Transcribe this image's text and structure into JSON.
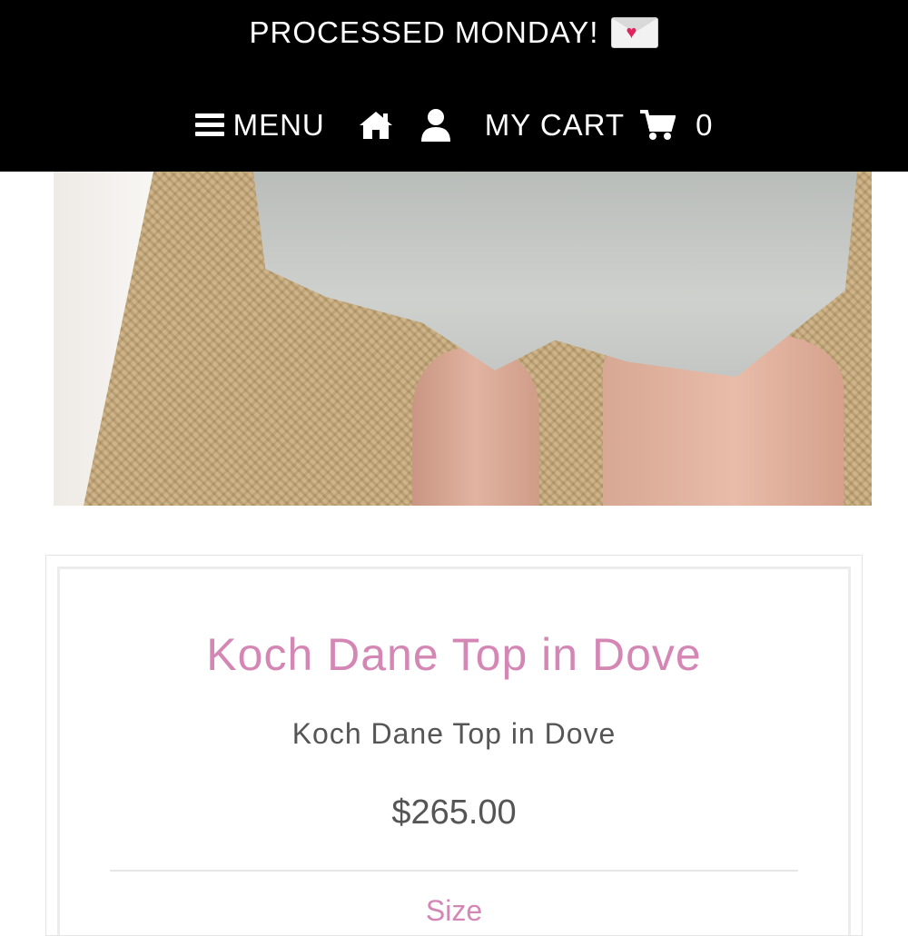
{
  "header": {
    "announcement": "PROCESSED MONDAY!",
    "announcement_icon": "love-letter-emoji",
    "nav": {
      "menu_label": "MENU",
      "cart_label": "MY CART",
      "cart_count": "0"
    }
  },
  "product": {
    "title": "Koch Dane Top in Dove",
    "subtitle": "Koch Dane Top in Dove",
    "price": "$265.00",
    "option_label": "Size"
  },
  "colors": {
    "header_bg": "#000000",
    "accent_pink": "#d487b5",
    "text_gray": "#555555"
  }
}
